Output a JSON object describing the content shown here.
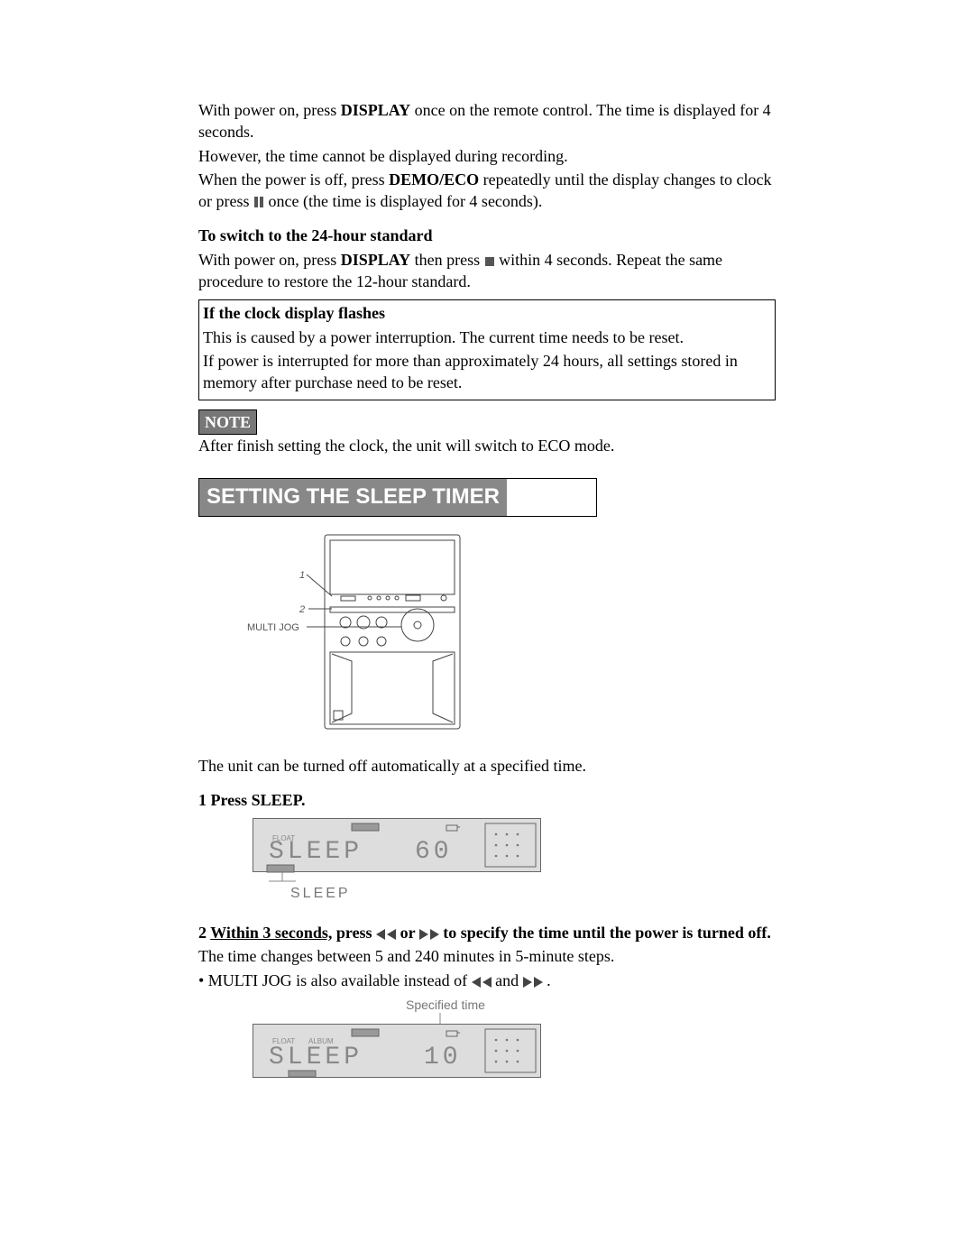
{
  "intro": {
    "p1a": "With power on, press ",
    "p1b": "DISPLAY",
    "p1c": " once on the remote control. The time is displayed for 4 seconds.",
    "p2": "However, the time cannot be displayed during recording.",
    "p3a": "When the power is off, press ",
    "p3b": "DEMO/ECO",
    "p3c": " repeatedly until the display changes to clock or press ",
    "p3d": " once (the time is displayed for 4 seconds)."
  },
  "switch24": {
    "heading": "To switch to the 24-hour standard",
    "body_a": "With power on, press ",
    "body_b": "DISPLAY",
    "body_c": " then press ",
    "body_d": " within 4 seconds. Repeat the same procedure to restore the 12-hour standard."
  },
  "clockbox": {
    "heading": "If the clock display flashes",
    "l1": "This is caused by a power interruption. The current time needs to be reset.",
    "l2": "If power is interrupted for more than approximately 24 hours, all settings stored in memory after purchase need to be reset."
  },
  "note": {
    "label": "NOTE",
    "body": "After finish setting the clock, the unit will switch to ECO mode."
  },
  "section_title": "SETTING THE SLEEP TIMER",
  "diagram": {
    "callout1": "1",
    "callout2": "2",
    "multijog": "MULTI JOG"
  },
  "after_diagram": "The unit can be turned off automatically at a specified time.",
  "step1": {
    "heading": "1 Press SLEEP.",
    "lcd_main": "SLEEP",
    "lcd_num": "60",
    "lcd_tag": "SLEEP",
    "caption": "SLEEP"
  },
  "step2": {
    "num": "2 ",
    "underlined": "Within 3 seconds,",
    "mid1": " press ",
    "mid2": " or ",
    "mid3": " to specify the time until the power is turned off.",
    "l2": "The time changes between 5 and 240 minutes in 5-minute steps.",
    "l3a": "• MULTI JOG is also available instead of ",
    "l3b": " and ",
    "l3c": ".",
    "spec_label": "Specified time",
    "lcd_main": "SLEEP",
    "lcd_num": "10",
    "lcd_tag": "SLEEP"
  }
}
